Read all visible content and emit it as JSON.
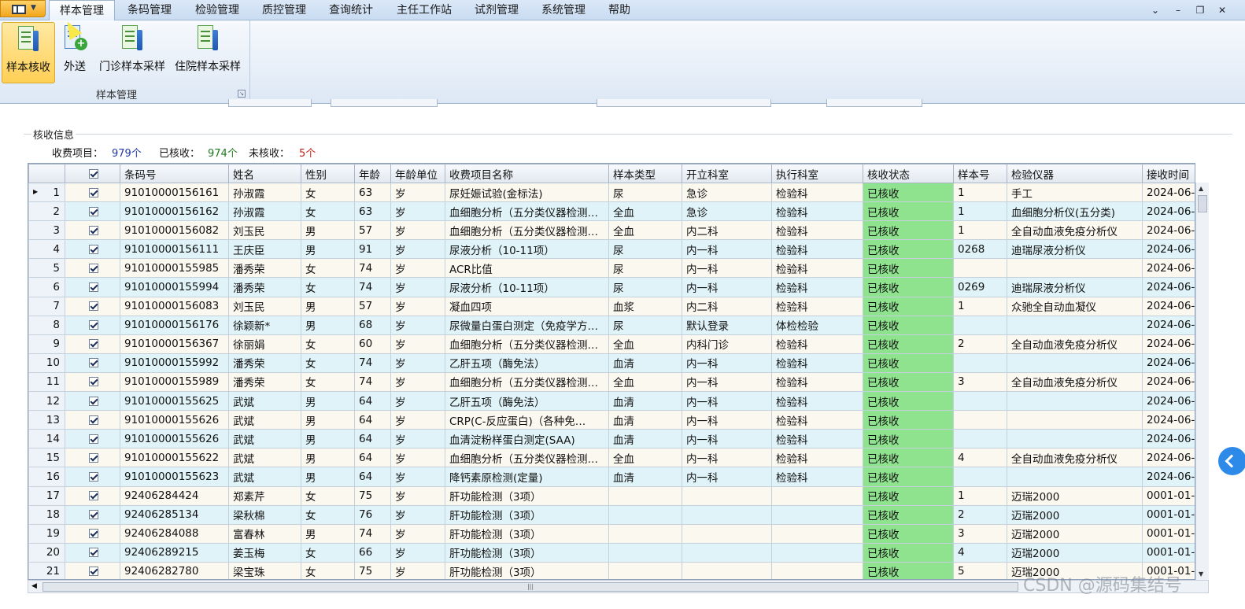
{
  "menu": {
    "tabs": [
      "样本管理",
      "条码管理",
      "检验管理",
      "质控管理",
      "查询统计",
      "主任工作站",
      "试剂管理",
      "系统管理",
      "帮助"
    ],
    "window_controls": [
      "help-chevron-icon",
      "minimize-icon",
      "restore-icon",
      "close-icon"
    ]
  },
  "ribbon": {
    "buttons": [
      "样本核收",
      "外送",
      "门诊样本采样",
      "住院样本采样"
    ],
    "group_label": "样本管理"
  },
  "panel": {
    "title": "核收信息",
    "charge_items_label": "收费项目：",
    "charge_items_value": "979个",
    "received_label": "已核收：",
    "received_value": "974个",
    "not_received_label": "未核收：",
    "not_received_value": "5个",
    "colors": {
      "charge": "#1f3aa6",
      "received": "#1d7a1d",
      "not_received": "#c0221a",
      "status_cell": "#8fe38f"
    }
  },
  "table": {
    "headers": [
      "",
      "",
      "条码号",
      "姓名",
      "性别",
      "年龄",
      "年龄单位",
      "收费项目名称",
      "样本类型",
      "开立科室",
      "执行科室",
      "核收状态",
      "样本号",
      "检验仪器",
      "接收时间"
    ],
    "rows": [
      [
        "1",
        "91010000156161",
        "孙淑霞",
        "女",
        "63",
        "岁",
        "尿妊娠试验(金标法)",
        "尿",
        "急诊",
        "检验科",
        "已核收",
        "1",
        "手工",
        "2024-06-"
      ],
      [
        "2",
        "91010000156162",
        "孙淑霞",
        "女",
        "63",
        "岁",
        "血细胞分析（五分类仪器检测…",
        "全血",
        "急诊",
        "检验科",
        "已核收",
        "1",
        "血细胞分析仪(五分类)",
        "2024-06-"
      ],
      [
        "3",
        "91010000156082",
        "刘玉民",
        "男",
        "57",
        "岁",
        "血细胞分析（五分类仪器检测…",
        "全血",
        "内二科",
        "检验科",
        "已核收",
        "1",
        "全自动血液免疫分析仪",
        "2024-06-"
      ],
      [
        "4",
        "91010000156111",
        "王庆臣",
        "男",
        "91",
        "岁",
        "尿液分析（10-11项）",
        "尿",
        "内一科",
        "检验科",
        "已核收",
        "0268",
        "迪瑞尿液分析仪",
        "2024-06-"
      ],
      [
        "5",
        "91010000155985",
        "潘秀荣",
        "女",
        "74",
        "岁",
        "ACR比值",
        "尿",
        "内一科",
        "检验科",
        "已核收",
        "",
        "",
        "2024-06-"
      ],
      [
        "6",
        "91010000155994",
        "潘秀荣",
        "女",
        "74",
        "岁",
        "尿液分析（10-11项）",
        "尿",
        "内一科",
        "检验科",
        "已核收",
        "0269",
        "迪瑞尿液分析仪",
        "2024-06-"
      ],
      [
        "7",
        "91010000156083",
        "刘玉民",
        "男",
        "57",
        "岁",
        "凝血四项",
        "血浆",
        "内二科",
        "检验科",
        "已核收",
        "1",
        "众驰全自动血凝仪",
        "2024-06-"
      ],
      [
        "8",
        "91010000156176",
        "徐颖新*",
        "男",
        "68",
        "岁",
        "尿微量白蛋白测定（免疫学方…",
        "尿",
        "默认登录",
        "体检检验",
        "已核收",
        "",
        "",
        "2024-06-"
      ],
      [
        "9",
        "91010000156367",
        "徐丽娟",
        "女",
        "60",
        "岁",
        "血细胞分析（五分类仪器检测…",
        "全血",
        "内科门诊",
        "检验科",
        "已核收",
        "2",
        "全自动血液免疫分析仪",
        "2024-06-"
      ],
      [
        "10",
        "91010000155992",
        "潘秀荣",
        "女",
        "74",
        "岁",
        "乙肝五项（酶免法）",
        "血清",
        "内一科",
        "检验科",
        "已核收",
        "",
        "",
        "2024-06-"
      ],
      [
        "11",
        "91010000155989",
        "潘秀荣",
        "女",
        "74",
        "岁",
        "血细胞分析（五分类仪器检测…",
        "全血",
        "内一科",
        "检验科",
        "已核收",
        "3",
        "全自动血液免疫分析仪",
        "2024-06-"
      ],
      [
        "12",
        "91010000155625",
        "武斌",
        "男",
        "64",
        "岁",
        "乙肝五项（酶免法）",
        "血清",
        "内一科",
        "检验科",
        "已核收",
        "",
        "",
        "2024-06-"
      ],
      [
        "13",
        "91010000155626",
        "武斌",
        "男",
        "64",
        "岁",
        "CRP(C-反应蛋白)（各种免…",
        "血清",
        "内一科",
        "检验科",
        "已核收",
        "",
        "",
        "2024-06-"
      ],
      [
        "14",
        "91010000155626",
        "武斌",
        "男",
        "64",
        "岁",
        "血清淀粉样蛋白测定(SAA)",
        "血清",
        "内一科",
        "检验科",
        "已核收",
        "",
        "",
        "2024-06-"
      ],
      [
        "15",
        "91010000155622",
        "武斌",
        "男",
        "64",
        "岁",
        "血细胞分析（五分类仪器检测…",
        "全血",
        "内一科",
        "检验科",
        "已核收",
        "4",
        "全自动血液免疫分析仪",
        "2024-06-"
      ],
      [
        "16",
        "91010000155623",
        "武斌",
        "男",
        "64",
        "岁",
        "降钙素原检测(定量)",
        "血清",
        "内一科",
        "检验科",
        "已核收",
        "",
        "",
        "2024-06-"
      ],
      [
        "17",
        "92406284424",
        "郑素芹",
        "女",
        "75",
        "岁",
        "肝功能检测（3项）",
        "",
        "",
        "",
        "已核收",
        "1",
        "迈瑞2000",
        "0001-01-"
      ],
      [
        "18",
        "92406285134",
        "梁秋棉",
        "女",
        "76",
        "岁",
        "肝功能检测（3项）",
        "",
        "",
        "",
        "已核收",
        "2",
        "迈瑞2000",
        "0001-01-"
      ],
      [
        "19",
        "92406284088",
        "富春林",
        "男",
        "74",
        "岁",
        "肝功能检测（3项）",
        "",
        "",
        "",
        "已核收",
        "3",
        "迈瑞2000",
        "0001-01-"
      ],
      [
        "20",
        "92406289215",
        "姜玉梅",
        "女",
        "66",
        "岁",
        "肝功能检测（3项）",
        "",
        "",
        "",
        "已核收",
        "4",
        "迈瑞2000",
        "0001-01-"
      ],
      [
        "21",
        "92406282780",
        "梁宝珠",
        "女",
        "75",
        "岁",
        "肝功能检测（3项）",
        "",
        "",
        "",
        "已核收",
        "5",
        "迈瑞2000",
        "0001-01-"
      ]
    ]
  },
  "watermark": "CSDN @源码集结号"
}
